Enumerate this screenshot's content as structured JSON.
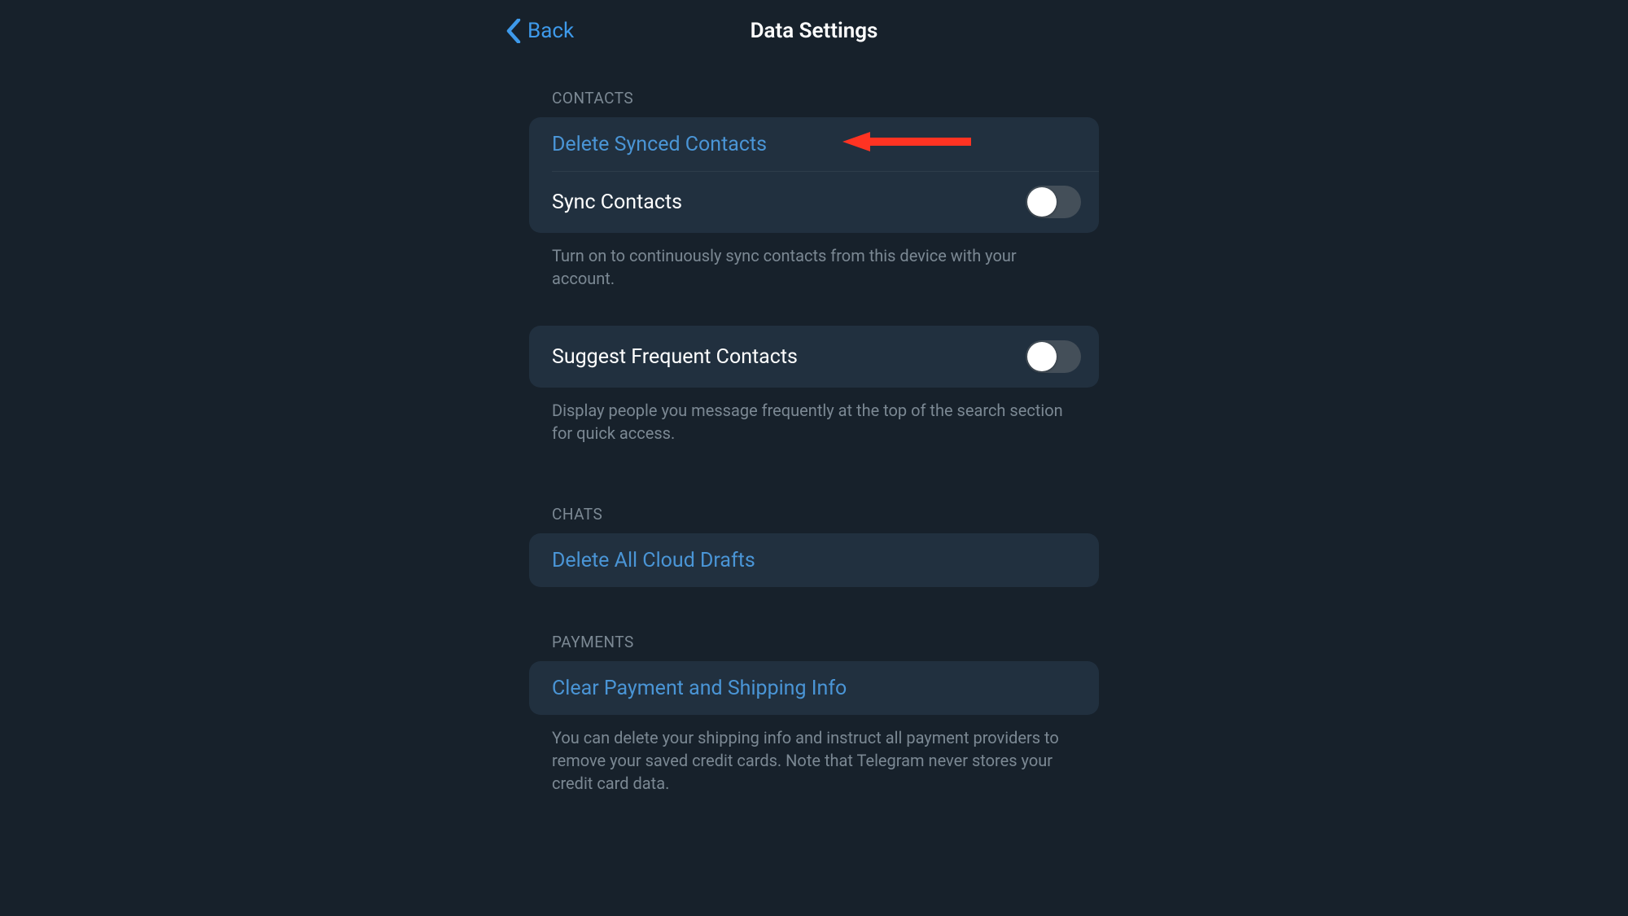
{
  "nav": {
    "back": "Back",
    "title": "Data Settings"
  },
  "sections": {
    "contacts": {
      "header": "CONTACTS",
      "delete_synced": "Delete Synced Contacts",
      "sync_contacts": "Sync Contacts",
      "sync_footer": "Turn on to continuously sync contacts from this device with your account.",
      "suggest_frequent": "Suggest Frequent Contacts",
      "suggest_footer": "Display people you message frequently at the top of the search section for quick access."
    },
    "chats": {
      "header": "CHATS",
      "delete_drafts": "Delete All Cloud Drafts"
    },
    "payments": {
      "header": "PAYMENTS",
      "clear_info": "Clear Payment and Shipping Info",
      "footer": "You can delete your shipping info and instruct all payment providers to remove your saved credit cards. Note that Telegram never stores your credit card data."
    }
  },
  "toggles": {
    "sync_contacts": false,
    "suggest_frequent": false
  },
  "colors": {
    "accent": "#3e9aeb",
    "link": "#4a95d6",
    "bg": "#17212b",
    "cell_bg": "#21303f",
    "muted": "#7b8893"
  }
}
